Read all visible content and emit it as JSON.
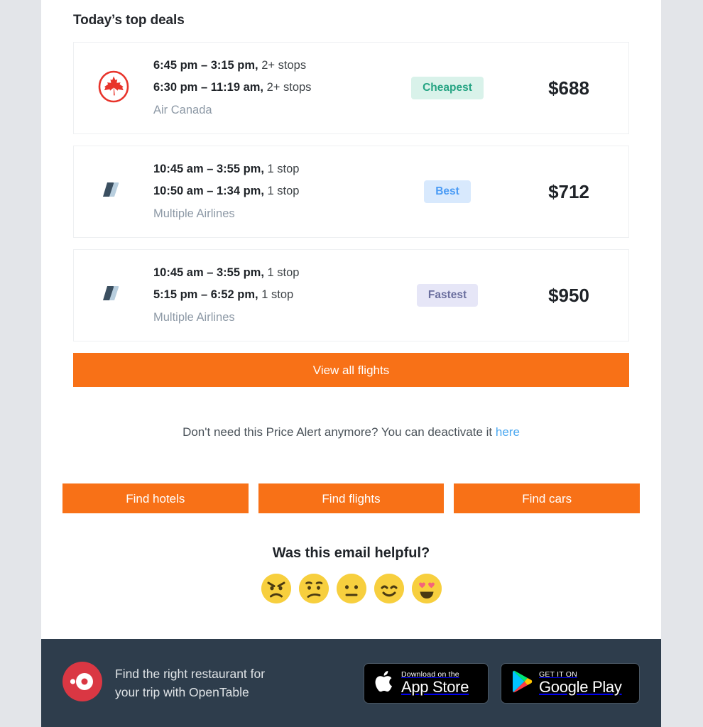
{
  "theme": {
    "page_background": "#e3e5e9",
    "body_background": "#ffffff",
    "accent_orange": "#f87117",
    "footer_background": "#2e3d4c",
    "link_blue": "#4ca8f0"
  },
  "deals_section": {
    "title": "Today’s top deals",
    "items": [
      {
        "logo": "air-canada-logo",
        "leg1_times": "6:45 pm – 3:15 pm,",
        "leg1_stops": " 2+ stops",
        "leg2_times": "6:30 pm – 11:19 am,",
        "leg2_stops": " 2+ stops",
        "airline": "Air Canada",
        "badge": "Cheapest",
        "badge_style": "cheapest",
        "badge_bg": "#d9f2ea",
        "badge_color": "#25a483",
        "price": "$688"
      },
      {
        "logo": "multiple-airlines-logo",
        "leg1_times": "10:45 am – 3:55 pm,",
        "leg1_stops": " 1 stop",
        "leg2_times": "10:50 am – 1:34 pm,",
        "leg2_stops": " 1 stop",
        "airline": "Multiple Airlines",
        "badge": "Best",
        "badge_style": "best",
        "badge_bg": "#d8e9fd",
        "badge_color": "#4a9bf5",
        "price": "$712"
      },
      {
        "logo": "multiple-airlines-logo",
        "leg1_times": "10:45 am – 3:55 pm,",
        "leg1_stops": " 1 stop",
        "leg2_times": "5:15 pm – 6:52 pm,",
        "leg2_stops": " 1 stop",
        "airline": "Multiple Airlines",
        "badge": "Fastest",
        "badge_style": "fastest",
        "badge_bg": "#e6e6f7",
        "badge_color": "#6a6e9e",
        "price": "$950"
      }
    ]
  },
  "cta": {
    "view_all_flights": "View all flights"
  },
  "deactivate": {
    "text": "Don't need this Price Alert anymore? You can deactivate it ",
    "link_label": "here"
  },
  "find_row": {
    "hotels": "Find hotels",
    "flights": "Find flights",
    "cars": "Find cars"
  },
  "feedback": {
    "title": "Was this email helpful?",
    "options": [
      {
        "name": "angry",
        "label": "Angry"
      },
      {
        "name": "sad",
        "label": "Sad"
      },
      {
        "name": "neutral",
        "label": "Neutral"
      },
      {
        "name": "happy",
        "label": "Happy"
      },
      {
        "name": "love",
        "label": "Love it"
      }
    ]
  },
  "footer": {
    "partner_logo": "opentable-logo",
    "promo_line1": "Find the right restaurant for",
    "promo_line2": "your trip with OpenTable",
    "app_store": {
      "small": "Download on the",
      "big": "App Store",
      "icon": "apple-icon"
    },
    "google_play": {
      "small": "GET IT ON",
      "big": "Google Play",
      "icon": "google-play-icon"
    }
  }
}
